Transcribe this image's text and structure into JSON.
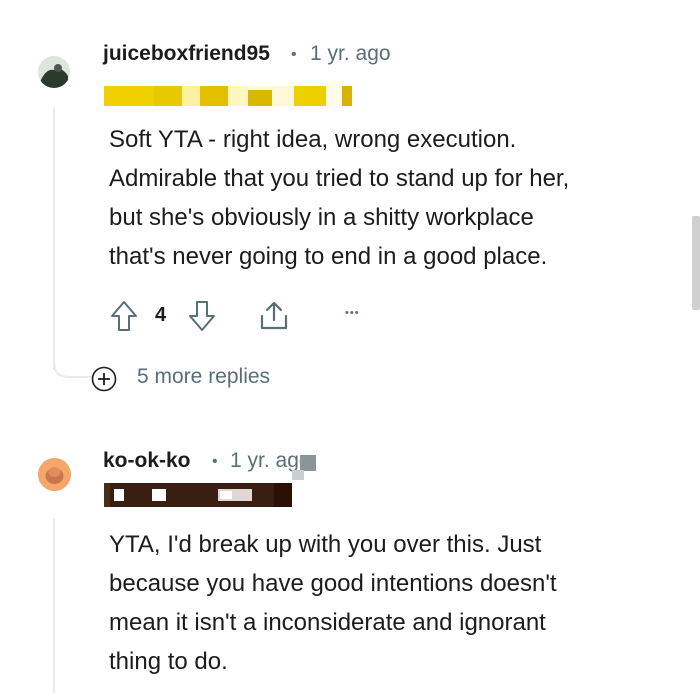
{
  "comments": [
    {
      "username": "juiceboxfriend95",
      "separator": "•",
      "time": "1 yr. ago",
      "body_lines": [
        "Soft YTA - right idea, wrong execution.",
        "Admirable that you tried to stand up for her,",
        "but she's obviously in a shitty workplace",
        "that's never going to end in a good place."
      ],
      "vote_count": "4",
      "more_replies": "5 more replies",
      "more_actions": "•••"
    },
    {
      "username": "ko-ok-ko",
      "separator": "•",
      "time": "1 yr. ago",
      "body_lines": [
        "YTA, I'd break up with you over this. Just",
        "because you have good intentions doesn't",
        "mean it isn't a inconsiderate and ignorant",
        "thing to do."
      ]
    }
  ],
  "icons": {
    "upvote": "upvote-icon",
    "downvote": "downvote-icon",
    "share": "share-icon",
    "more": "more-options-icon",
    "expand": "plus-circle-icon"
  },
  "colors": {
    "flair_1": "#f0d000",
    "flair_2": "#3a1e12",
    "meta": "#576f76",
    "thread_line": "#e5ebee"
  }
}
